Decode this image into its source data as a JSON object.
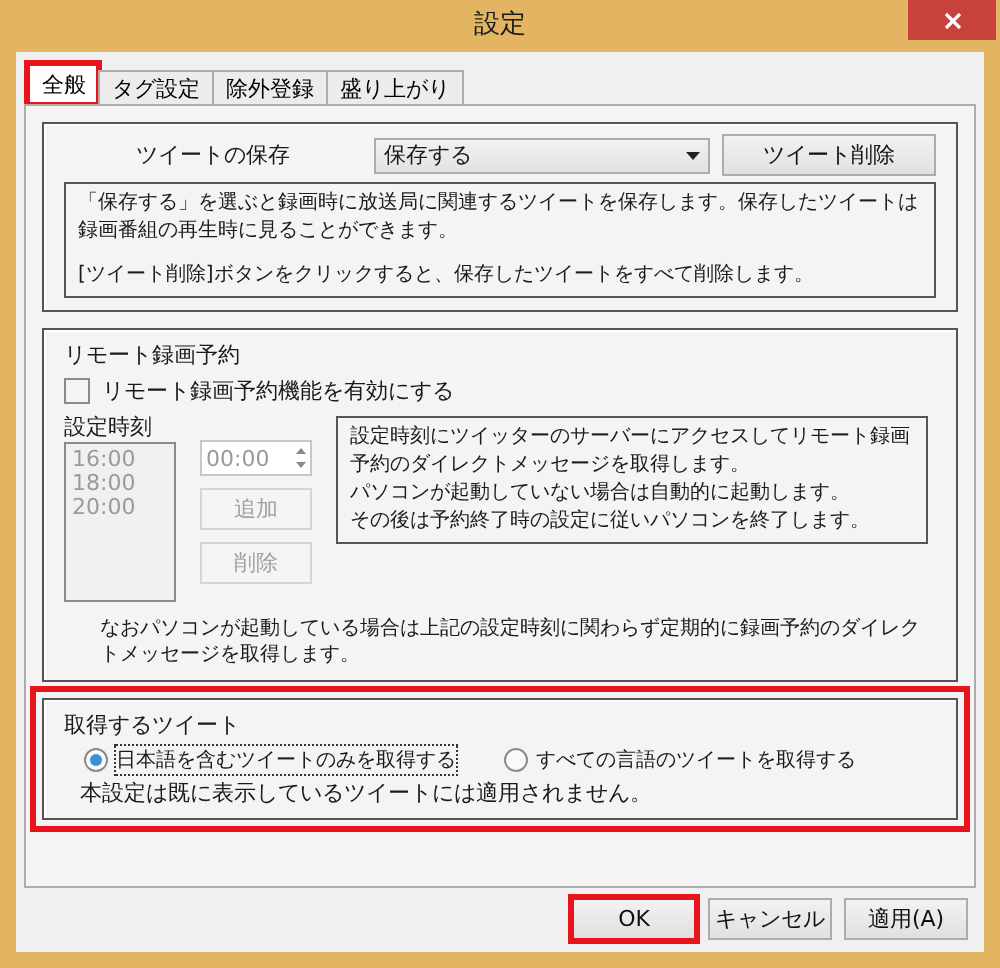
{
  "window": {
    "title": "設定"
  },
  "tabs": [
    {
      "label": "全般",
      "selected": true,
      "highlighted": true
    },
    {
      "label": "タグ設定",
      "selected": false,
      "highlighted": false
    },
    {
      "label": "除外登録",
      "selected": false,
      "highlighted": false
    },
    {
      "label": "盛り上がり",
      "selected": false,
      "highlighted": false
    }
  ],
  "tweet_storage": {
    "label": "ツイートの保存",
    "dropdown": {
      "value": "保存する"
    },
    "delete_button": "ツイート削除",
    "description": [
      "「保存する」を選ぶと録画時に放送局に関連するツイートを保存します。保存したツイートは録画番組の再生時に見ることができます。",
      "[ツイート削除]ボタンをクリックすると、保存したツイートをすべて削除します。"
    ]
  },
  "remote_recording": {
    "title": "リモート録画予約",
    "checkbox": {
      "label": "リモート録画予約機能を有効にする",
      "checked": false
    },
    "times_label": "設定時刻",
    "times": [
      {
        "label": "16:00",
        "disabled": true
      },
      {
        "label": "18:00",
        "disabled": true
      },
      {
        "label": "20:00",
        "disabled": true
      }
    ],
    "time_input": {
      "value": "00:00",
      "disabled": true
    },
    "buttons": [
      {
        "label": "追加",
        "disabled": true
      },
      {
        "label": "削除",
        "disabled": true
      }
    ],
    "info": [
      "設定時刻にツイッターのサーバーにアクセスしてリモート録画予約のダイレクトメッセージを取得します。",
      "パソコンが起動していない場合は自動的に起動します。",
      "その後は予約終了時の設定に従いパソコンを終了します。"
    ],
    "note": "なおパソコンが起動している場合は上記の設定時刻に関わらず定期的に録画予約のダイレクトメッセージを取得します。"
  },
  "fetch_tweets": {
    "title": "取得するツイート",
    "highlighted": true,
    "options": [
      {
        "label": "日本語を含むツイートのみを取得する",
        "selected": true
      },
      {
        "label": "すべての言語のツイートを取得する",
        "selected": false
      }
    ],
    "note": "本設定は既に表示しているツイートには適用されません。"
  },
  "buttons": [
    {
      "label": "OK",
      "highlighted": true
    },
    {
      "label": "キャンセル",
      "highlighted": false
    },
    {
      "label": "適用(A)",
      "highlighted": false
    }
  ]
}
